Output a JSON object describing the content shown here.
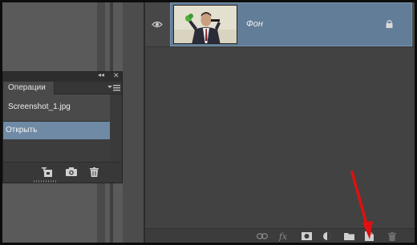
{
  "layers": {
    "items": [
      {
        "name": "Фон",
        "visible": true,
        "locked": true,
        "selected": true
      }
    ],
    "footer_icons": [
      "link-layers-icon",
      "fx-icon",
      "add-mask-icon",
      "adjustment-layer-icon",
      "new-group-icon",
      "new-layer-icon",
      "delete-layer-icon"
    ],
    "fx_label": "fx"
  },
  "operations": {
    "title_controls": {
      "collapse": "◂◂",
      "close": "✕"
    },
    "tab_label": "Операции",
    "items": [
      {
        "label": "Screenshot_1.jpg",
        "selected": false
      },
      {
        "label": "Открыть",
        "selected": true
      }
    ],
    "footer_icons": [
      "new-snapshot-icon",
      "camera-icon",
      "trash-icon"
    ]
  },
  "colors": {
    "selection": "#617d98",
    "ops_selection": "#6e8aa5",
    "annotation_arrow": "#e01010"
  }
}
